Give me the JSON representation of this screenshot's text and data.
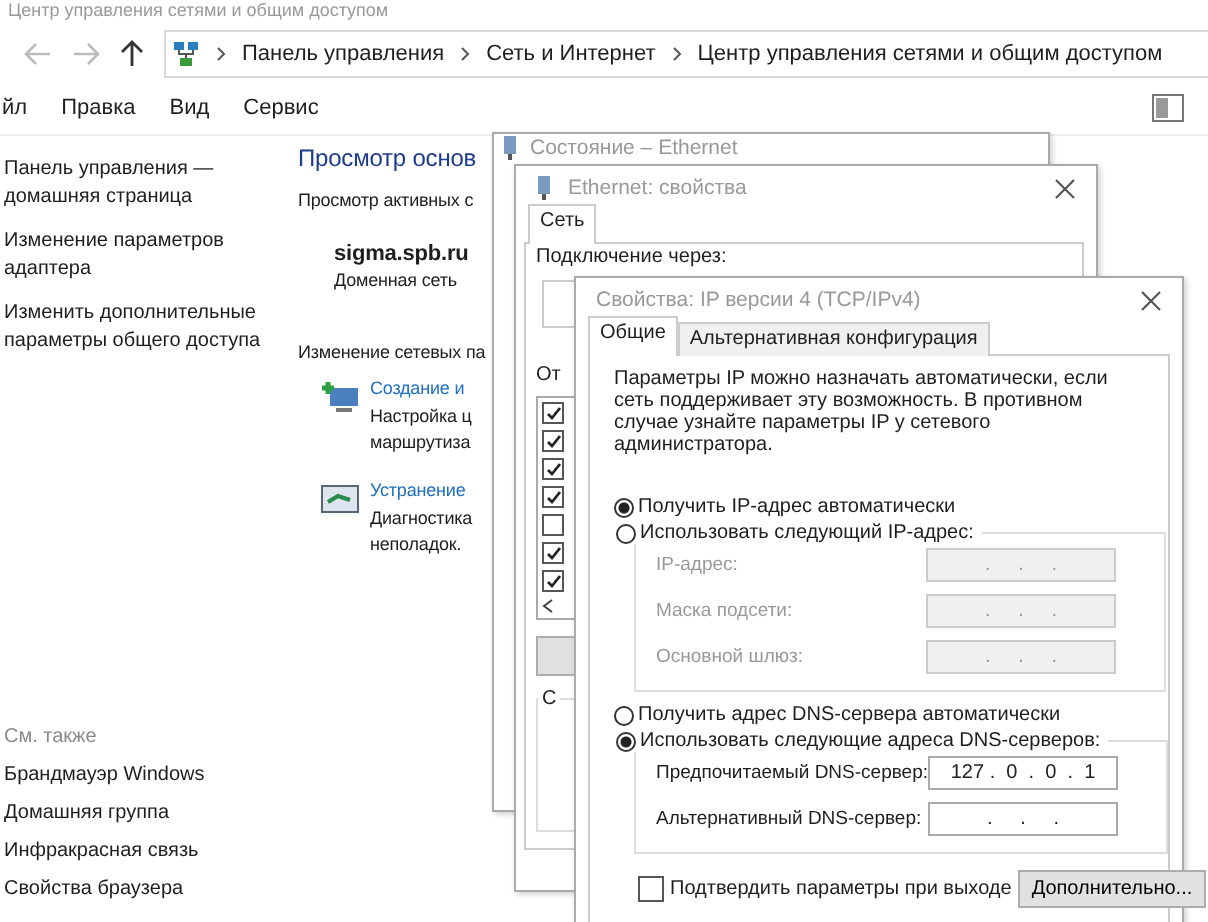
{
  "window": {
    "title": "Центр управления сетями и общим доступом"
  },
  "nav": {
    "breadcrumbs": [
      "Панель управления",
      "Сеть и Интернет",
      "Центр управления сетями и общим доступом"
    ]
  },
  "menu": [
    "йл",
    "Правка",
    "Вид",
    "Сервис"
  ],
  "sidebar": {
    "links": [
      "Панель управления — домашняя страница",
      "Изменение параметров адаптера",
      "Изменить дополнительные параметры общего доступа"
    ],
    "see_also_title": "См. также",
    "see_also": [
      "Брандмауэр Windows",
      "Домашняя группа",
      "Инфракрасная связь",
      "Свойства браузера"
    ]
  },
  "main": {
    "heading": "Просмотр основ",
    "active_label": "Просмотр активных с",
    "network_name": "sigma.spb.ru",
    "network_type": "Доменная сеть",
    "change_label": "Изменение сетевых па",
    "tasks": [
      {
        "title": "Создание и",
        "lines": [
          "Настройка ц",
          "маршрутиза"
        ]
      },
      {
        "title": "Устранение",
        "lines": [
          "Диагностика",
          "неполадок."
        ]
      }
    ]
  },
  "status_dialog": {
    "title": "Состояние – Ethernet"
  },
  "properties_dialog": {
    "title": "Ethernet: свойства",
    "tabs": [
      {
        "label": "Сеть",
        "selected": true
      }
    ],
    "connect_label": "Подключение через:",
    "components_label": "От",
    "components": [
      {
        "checked": true
      },
      {
        "checked": true
      },
      {
        "checked": true
      },
      {
        "checked": true
      },
      {
        "checked": false
      },
      {
        "checked": true
      },
      {
        "checked": true
      }
    ],
    "group_label": "С"
  },
  "ipv4_dialog": {
    "title": "Свойства: IP версии 4 (TCP/IPv4)",
    "tabs": [
      {
        "label": "Общие",
        "selected": true
      },
      {
        "label": "Альтернативная конфигурация",
        "selected": false
      }
    ],
    "description": "Параметры IP можно назначать автоматически, если сеть поддерживает эту возможность. В противном случае узнайте параметры IP у сетевого администратора.",
    "ip_options": [
      {
        "label": "Получить IP-адрес автоматически",
        "selected": true
      },
      {
        "label": "Использовать следующий IP-адрес:",
        "selected": false
      }
    ],
    "ip_fields": [
      {
        "label": "IP-адрес:",
        "value": ".     .     .",
        "disabled": true
      },
      {
        "label": "Маска подсети:",
        "value": ".     .     .",
        "disabled": true
      },
      {
        "label": "Основной шлюз:",
        "value": ".     .     .",
        "disabled": true
      }
    ],
    "dns_options": [
      {
        "label": "Получить адрес DNS-сервера автоматически",
        "selected": false
      },
      {
        "label": "Использовать следующие адреса DNS-серверов:",
        "selected": true
      }
    ],
    "dns_fields": [
      {
        "label": "Предпочитаемый DNS-сервер:",
        "value": "127 .  0  .  0  .  1",
        "disabled": false
      },
      {
        "label": "Альтернативный DNS-сервер:",
        "value": ".     .     .",
        "disabled": false
      }
    ],
    "confirm": {
      "label": "Подтвердить параметры при выходе",
      "checked": false
    },
    "advanced_button": "Дополнительно..."
  }
}
